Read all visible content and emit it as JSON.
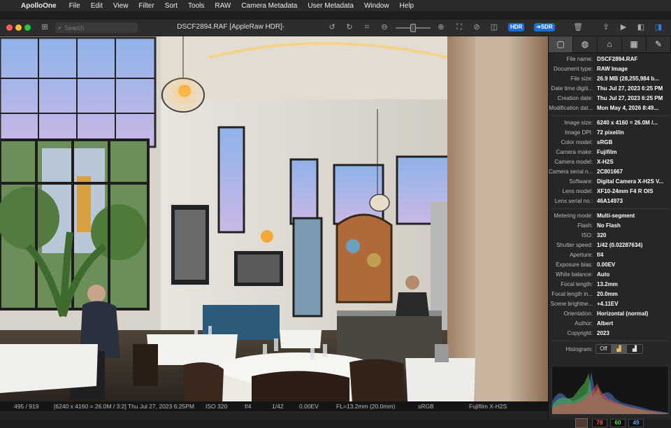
{
  "menubar": {
    "app_name": "ApolloOne",
    "items": [
      "File",
      "Edit",
      "View",
      "Filter",
      "Sort",
      "Tools",
      "RAW",
      "Camera Metadata",
      "User Metadata",
      "Window",
      "Help"
    ]
  },
  "window": {
    "title": "DSCF2894.RAF [AppleRaw HDR]",
    "modified_dot": "•",
    "search_placeholder": "Search",
    "hdr_label": "HDR",
    "sdr_label": "➜SDR"
  },
  "status": {
    "position": "495 / 919",
    "info": "[6240 x 4160 = 26.0M / 3:2] Thu Jul 27, 2023  6:25PM",
    "iso": "ISO 320",
    "aperture": "f/4",
    "shutter": "1/42",
    "exposure": "0.00EV",
    "focal": "FL=13.2mm (20.0mm)",
    "color": "sRGB",
    "camera": "Fujifilm X-H2S"
  },
  "inspector": {
    "tabs": [
      "▢",
      "◍",
      "⌂",
      "▦",
      "✎"
    ],
    "groups": [
      [
        {
          "k": "File name:",
          "v": "DSCF2894.RAF"
        },
        {
          "k": "Document type:",
          "v": "RAW Image"
        },
        {
          "k": "File size:",
          "v": "26.9 MB (28,255,984 b..."
        },
        {
          "k": "Date time digiti...",
          "v": "Thu Jul 27, 2023  6:25 PM"
        },
        {
          "k": "Creation date:",
          "v": "Thu Jul 27, 2023  6:25 PM"
        },
        {
          "k": "Modification dat...",
          "v": "Mon May 4, 2026  8:49..."
        }
      ],
      [
        {
          "k": "Image size:",
          "v": "6240 x 4160 = 26.0M /..."
        },
        {
          "k": "Image DPI:",
          "v": "72 pixel/in"
        },
        {
          "k": "Color model:",
          "v": "sRGB"
        },
        {
          "k": "Camera make:",
          "v": "Fujifilm"
        },
        {
          "k": "Camera model:",
          "v": "X-H2S"
        },
        {
          "k": "Camera serial n...",
          "v": "2C801667"
        },
        {
          "k": "Software:",
          "v": "Digital Camera X-H2S V..."
        },
        {
          "k": "Lens model:",
          "v": "XF10-24mm F4 R OIS"
        },
        {
          "k": "Lens serial no.:",
          "v": "46A14973"
        }
      ],
      [
        {
          "k": "Metering mode:",
          "v": "Multi-segment"
        },
        {
          "k": "Flash:",
          "v": "No Flash"
        },
        {
          "k": "ISO:",
          "v": "320"
        },
        {
          "k": "Shutter speed:",
          "v": "1/42 (0.02287634)"
        },
        {
          "k": "Aperture:",
          "v": "f/4"
        },
        {
          "k": "Exposure bias:",
          "v": "0.00EV"
        },
        {
          "k": "White balance:",
          "v": "Auto"
        },
        {
          "k": "Focal length:",
          "v": "13.2mm"
        },
        {
          "k": "Focal length in...",
          "v": "20.0mm"
        },
        {
          "k": "Scene brightne...",
          "v": "+4.11EV"
        },
        {
          "k": "Orientation:",
          "v": "Horizontal (normal)"
        },
        {
          "k": "Author:",
          "v": "Albert"
        },
        {
          "k": "Copyright:",
          "v": "2023"
        }
      ]
    ],
    "histogram_label": "Histogram:",
    "histogram_off": "Off",
    "pixel_rgb": {
      "r": "78",
      "g": "60",
      "b": "49"
    },
    "colors": {
      "r": "#ff5050",
      "g": "#50e050",
      "b": "#50a0ff",
      "swatch": "#4e3c31"
    }
  }
}
